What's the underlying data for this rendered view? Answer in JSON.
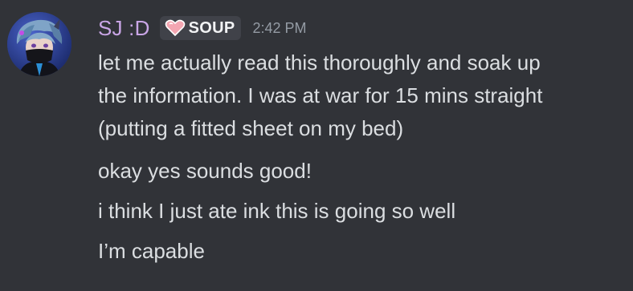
{
  "author": {
    "username": "SJ :D",
    "avatar_icon": "avatar-icon",
    "name_color": "#c9a5e6"
  },
  "tag": {
    "label": "SOUP",
    "icon": "heart-icon",
    "icon_color": "#f4a6b2"
  },
  "timestamp": "2:42 PM",
  "messages": [
    {
      "lines": [
        "let me actually read this thoroughly and soak up",
        "the information. I was at war for 15 mins straight",
        "(putting a fitted sheet on my bed)"
      ]
    },
    {
      "text": "okay yes sounds good!"
    },
    {
      "text": "i think I just ate ink this is going so well"
    },
    {
      "text": "I’m capable"
    }
  ],
  "colors": {
    "background": "#313338",
    "text": "#dbdee1",
    "timestamp": "#949ba4",
    "tag_background": "#404249"
  }
}
